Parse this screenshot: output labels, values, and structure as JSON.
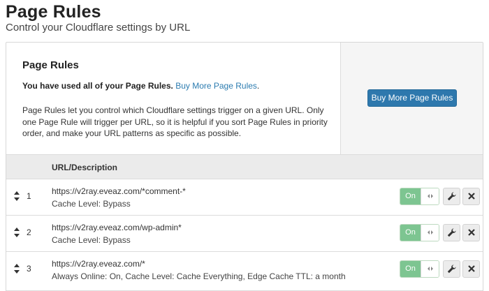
{
  "header": {
    "title": "Page Rules",
    "subtitle": "Control your Cloudflare settings by URL"
  },
  "info": {
    "heading": "Page Rules",
    "used_text": "You have used all of your Page Rules.",
    "used_link": "Buy More Page Rules",
    "used_suffix": ".",
    "description": "Page Rules let you control which Cloudflare settings trigger on a given URL. Only one Page Rule will trigger per URL, so it is helpful if you sort Page Rules in priority order, and make your URL patterns as specific as possible."
  },
  "buy_button": "Buy More Page Rules",
  "table": {
    "column_header": "URL/Description",
    "rows": [
      {
        "priority": "1",
        "url": "https://v2ray.eveaz.com/*comment-*",
        "settings": "Cache Level: Bypass",
        "status": "On"
      },
      {
        "priority": "2",
        "url": "https://v2ray.eveaz.com/wp-admin*",
        "settings": "Cache Level: Bypass",
        "status": "On"
      },
      {
        "priority": "3",
        "url": "https://v2ray.eveaz.com/*",
        "settings": "Always Online: On, Cache Level: Cache Everything, Edge Cache TTL: a month",
        "status": "On"
      }
    ]
  },
  "colors": {
    "accent": "#2e78ad",
    "toggle_on": "#7dc591",
    "link": "#2c7cb0"
  },
  "icons": [
    "sort-handle-icon",
    "toggle-arrows-icon",
    "wrench-icon",
    "close-icon"
  ]
}
